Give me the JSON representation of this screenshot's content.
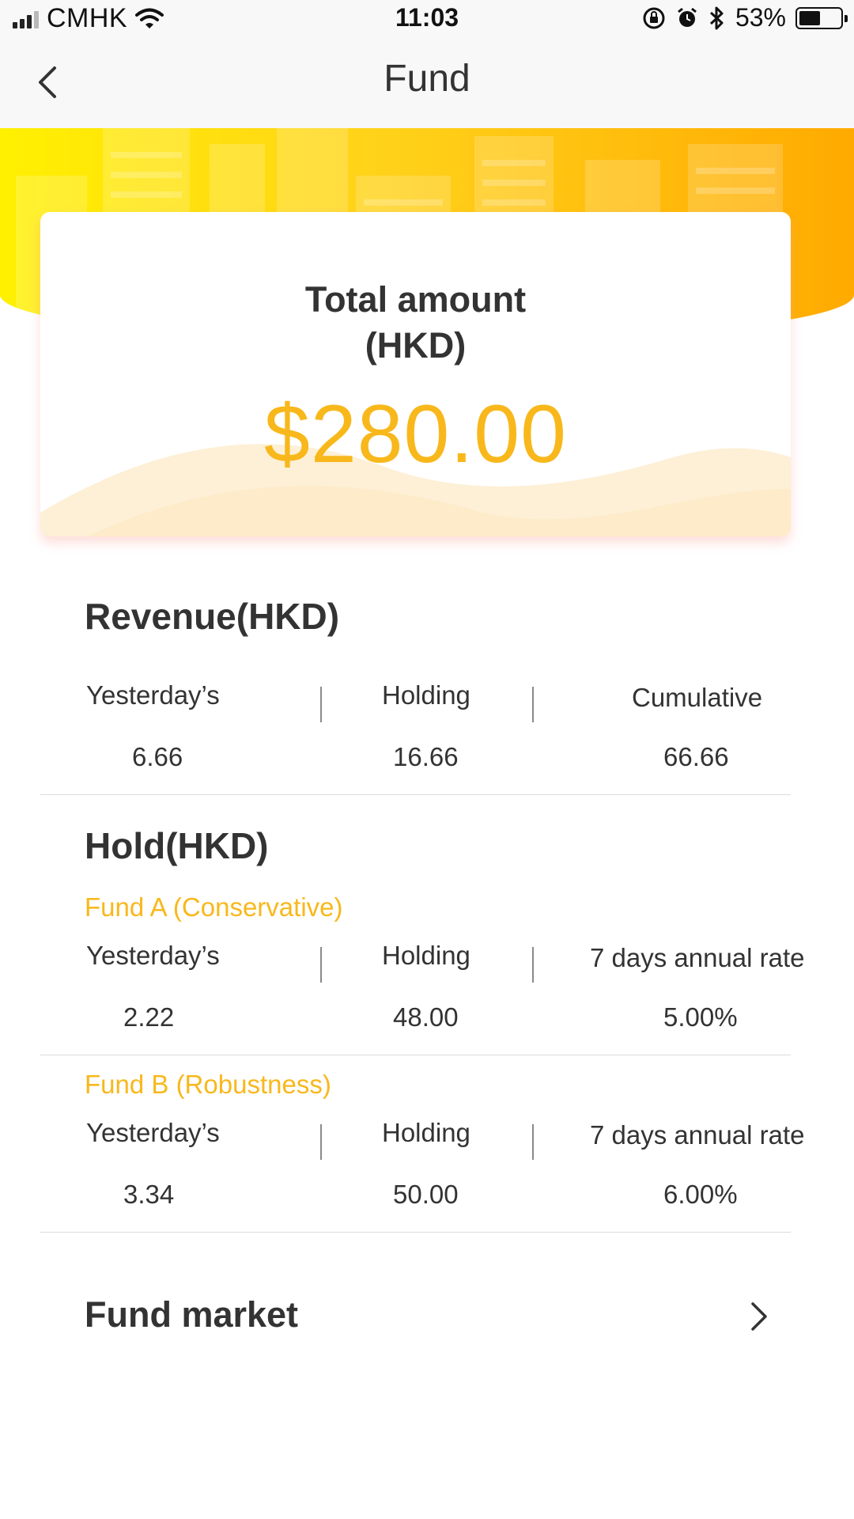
{
  "status_bar": {
    "carrier": "CMHK",
    "time": "11:03",
    "battery_percent": "53%",
    "battery_level": 0.53,
    "signal_bars": 3,
    "signal_max": 4,
    "icons": [
      "signal-icon",
      "wifi-icon",
      "rotation-lock-icon",
      "alarm-icon",
      "bluetooth-icon",
      "battery-icon"
    ]
  },
  "nav": {
    "title": "Fund",
    "back_icon": "chevron-left-icon"
  },
  "summary": {
    "title_line1": "Total amount",
    "title_line2": "(HKD)",
    "amount": "$280.00"
  },
  "revenue": {
    "title": "Revenue(HKD)",
    "stats": [
      {
        "label": "Yesterday’s",
        "value": "6.66"
      },
      {
        "label": "Holding",
        "value": "16.66"
      },
      {
        "label": "Cumulative",
        "value": "66.66"
      }
    ]
  },
  "hold": {
    "title": "Hold(HKD)",
    "funds": [
      {
        "name": "Fund A (Conservative)",
        "stats": [
          {
            "label": "Yesterday’s",
            "value": "2.22"
          },
          {
            "label": "Holding",
            "value": "48.00"
          },
          {
            "label": "7 days annual rate",
            "value": "5.00%"
          }
        ]
      },
      {
        "name": "Fund B (Robustness)",
        "stats": [
          {
            "label": "Yesterday’s",
            "value": "3.34"
          },
          {
            "label": "Holding",
            "value": "50.00"
          },
          {
            "label": "7 days annual rate",
            "value": "6.00%"
          }
        ]
      }
    ]
  },
  "market": {
    "label": "Fund market",
    "icon": "chevron-right-icon"
  },
  "colors": {
    "accent": "#f8b81c",
    "banner_start": "#fff000",
    "banner_end": "#ffaa00",
    "text": "#333333"
  }
}
